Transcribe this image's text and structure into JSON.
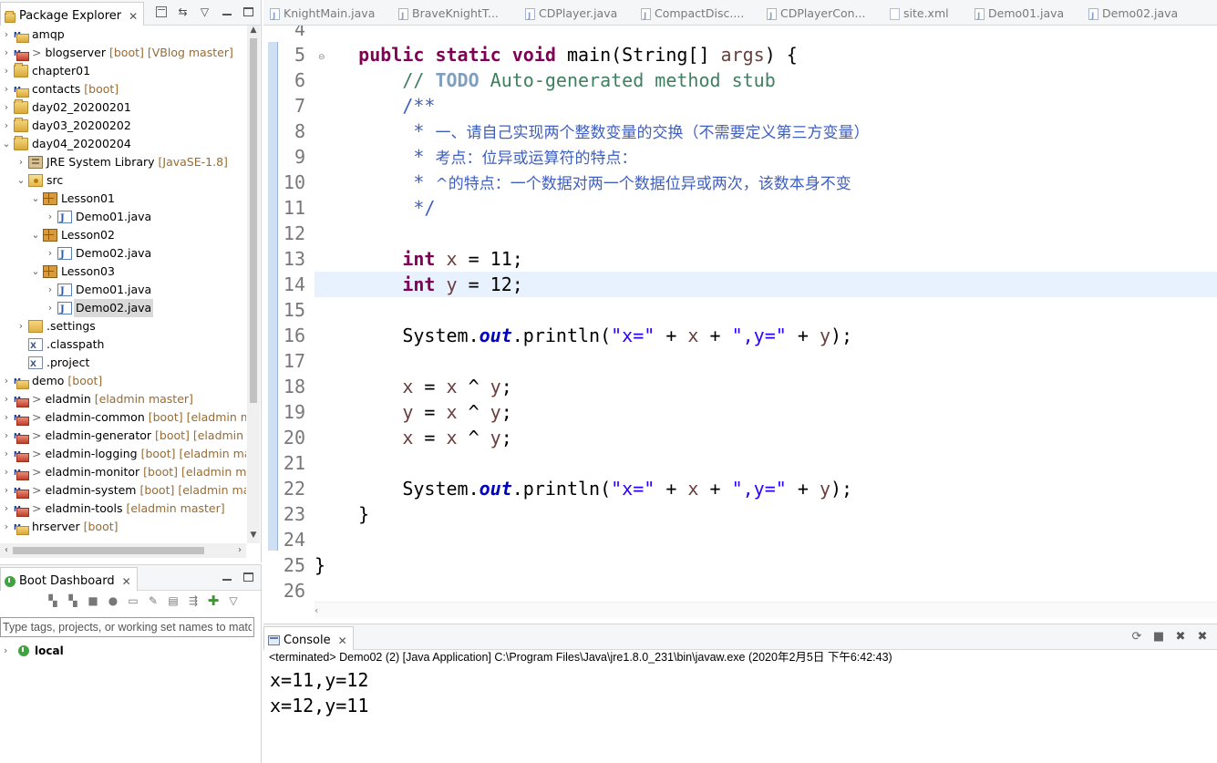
{
  "package_explorer": {
    "title": "Package Explorer",
    "tree": [
      {
        "indent": 0,
        "arrow": "›",
        "icon": "maven-project",
        "label": "amqp",
        "decoration": ""
      },
      {
        "indent": 0,
        "arrow": "›",
        "icon": "maven-project-red",
        "prefix": "> ",
        "label": "blogserver",
        "decoration": " [boot] [VBlog master]"
      },
      {
        "indent": 0,
        "arrow": "›",
        "icon": "project",
        "label": "chapter01",
        "decoration": ""
      },
      {
        "indent": 0,
        "arrow": "›",
        "icon": "maven-project",
        "label": "contacts",
        "decoration": " [boot]"
      },
      {
        "indent": 0,
        "arrow": "›",
        "icon": "project",
        "label": "day02_20200201",
        "decoration": ""
      },
      {
        "indent": 0,
        "arrow": "›",
        "icon": "project",
        "label": "day03_20200202",
        "decoration": ""
      },
      {
        "indent": 0,
        "arrow": "⌄",
        "icon": "project",
        "label": "day04_20200204",
        "decoration": ""
      },
      {
        "indent": 1,
        "arrow": "›",
        "icon": "library",
        "label": "JRE System Library",
        "decoration": " [JavaSE-1.8]"
      },
      {
        "indent": 1,
        "arrow": "⌄",
        "icon": "source-folder",
        "label": "src",
        "decoration": ""
      },
      {
        "indent": 2,
        "arrow": "⌄",
        "icon": "package",
        "label": "Lesson01",
        "decoration": ""
      },
      {
        "indent": 3,
        "arrow": "›",
        "icon": "java-file",
        "label": "Demo01.java",
        "decoration": ""
      },
      {
        "indent": 2,
        "arrow": "⌄",
        "icon": "package",
        "label": "Lesson02",
        "decoration": ""
      },
      {
        "indent": 3,
        "arrow": "›",
        "icon": "java-file",
        "label": "Demo02.java",
        "decoration": ""
      },
      {
        "indent": 2,
        "arrow": "⌄",
        "icon": "package",
        "label": "Lesson03",
        "decoration": ""
      },
      {
        "indent": 3,
        "arrow": "›",
        "icon": "java-file",
        "label": "Demo01.java",
        "decoration": ""
      },
      {
        "indent": 3,
        "arrow": "›",
        "icon": "java-file",
        "label": "Demo02.java",
        "decoration": "",
        "selected": true
      },
      {
        "indent": 1,
        "arrow": "›",
        "icon": "folder",
        "label": ".settings",
        "decoration": ""
      },
      {
        "indent": 1,
        "arrow": "",
        "icon": "xml-file",
        "label": ".classpath",
        "decoration": ""
      },
      {
        "indent": 1,
        "arrow": "",
        "icon": "xml-file",
        "label": ".project",
        "decoration": ""
      },
      {
        "indent": 0,
        "arrow": "›",
        "icon": "maven-project",
        "label": "demo",
        "decoration": " [boot]"
      },
      {
        "indent": 0,
        "arrow": "›",
        "icon": "maven-project-red",
        "prefix": "> ",
        "label": "eladmin",
        "decoration": " [eladmin master]"
      },
      {
        "indent": 0,
        "arrow": "›",
        "icon": "maven-project-red",
        "prefix": "> ",
        "label": "eladmin-common",
        "decoration": " [boot] [eladmin master]"
      },
      {
        "indent": 0,
        "arrow": "›",
        "icon": "maven-project-red",
        "prefix": "> ",
        "label": "eladmin-generator",
        "decoration": " [boot] [eladmin master]"
      },
      {
        "indent": 0,
        "arrow": "›",
        "icon": "maven-project-red",
        "prefix": "> ",
        "label": "eladmin-logging",
        "decoration": " [boot] [eladmin master]"
      },
      {
        "indent": 0,
        "arrow": "›",
        "icon": "maven-project-red",
        "prefix": "> ",
        "label": "eladmin-monitor",
        "decoration": " [boot] [eladmin master]"
      },
      {
        "indent": 0,
        "arrow": "›",
        "icon": "maven-project-red",
        "prefix": "> ",
        "label": "eladmin-system",
        "decoration": " [boot] [eladmin master]"
      },
      {
        "indent": 0,
        "arrow": "›",
        "icon": "maven-project-red",
        "prefix": "> ",
        "label": "eladmin-tools",
        "decoration": " [eladmin master]"
      },
      {
        "indent": 0,
        "arrow": "›",
        "icon": "maven-project",
        "label": "hrserver",
        "decoration": " [boot]"
      }
    ]
  },
  "boot_dashboard": {
    "title": "Boot Dashboard",
    "filter_placeholder": "Type tags, projects, or working set names to match",
    "local_label": "local"
  },
  "editor": {
    "tabs": [
      {
        "label": "KnightMain.java",
        "icon": "java-file"
      },
      {
        "label": "BraveKnightT...",
        "icon": "java-file"
      },
      {
        "label": "CDPlayer.java",
        "icon": "java-file"
      },
      {
        "label": "CompactDisc....",
        "icon": "java-file"
      },
      {
        "label": "CDPlayerCon...",
        "icon": "java-file"
      },
      {
        "label": "site.xml",
        "icon": "xml-file"
      },
      {
        "label": "Demo01.java",
        "icon": "java-file"
      },
      {
        "label": "Demo02.java",
        "icon": "java-file"
      }
    ],
    "current_line": 14,
    "lines": [
      {
        "num": "4",
        "tokens": []
      },
      {
        "num": "5",
        "tokens": [
          [
            "",
            "    "
          ],
          [
            "kw",
            "public static void"
          ],
          [
            "",
            " main(String[] "
          ],
          [
            "var",
            "args"
          ],
          [
            "",
            ") {"
          ]
        ]
      },
      {
        "num": "6",
        "tokens": [
          [
            "",
            "        "
          ],
          [
            "cm",
            "// "
          ],
          [
            "todo",
            "TODO"
          ],
          [
            "cm",
            " Auto-generated method stub"
          ]
        ]
      },
      {
        "num": "7",
        "tokens": [
          [
            "",
            "        "
          ],
          [
            "jd",
            "/**"
          ]
        ]
      },
      {
        "num": "8",
        "tokens": [
          [
            "",
            "         "
          ],
          [
            "jd",
            "* "
          ],
          [
            "jdcn",
            "一、请自己实现两个整数变量的交换（不需要定义第三方变量）"
          ]
        ]
      },
      {
        "num": "9",
        "tokens": [
          [
            "",
            "         "
          ],
          [
            "jd",
            "* "
          ],
          [
            "jdcn",
            "考点：位异或运算符的特点："
          ]
        ]
      },
      {
        "num": "10",
        "tokens": [
          [
            "",
            "         "
          ],
          [
            "jd",
            "* "
          ],
          [
            "jdcn",
            "^的特点：一个数据对两一个数据位异或两次，该数本身不变"
          ]
        ]
      },
      {
        "num": "11",
        "tokens": [
          [
            "",
            "         "
          ],
          [
            "jd",
            "*/"
          ]
        ]
      },
      {
        "num": "12",
        "tokens": []
      },
      {
        "num": "13",
        "tokens": [
          [
            "",
            "        "
          ],
          [
            "kw",
            "int"
          ],
          [
            "",
            " "
          ],
          [
            "var",
            "x"
          ],
          [
            "",
            " = 11;"
          ]
        ]
      },
      {
        "num": "14",
        "tokens": [
          [
            "",
            "        "
          ],
          [
            "kw",
            "int"
          ],
          [
            "",
            " "
          ],
          [
            "var",
            "y"
          ],
          [
            "",
            " = 12;"
          ]
        ]
      },
      {
        "num": "15",
        "tokens": []
      },
      {
        "num": "16",
        "tokens": [
          [
            "",
            "        System."
          ],
          [
            "fld",
            "out"
          ],
          [
            "",
            ".println("
          ],
          [
            "str",
            "\"x=\""
          ],
          [
            "",
            " + "
          ],
          [
            "var",
            "x"
          ],
          [
            "",
            " + "
          ],
          [
            "str",
            "\",y=\""
          ],
          [
            "",
            " + "
          ],
          [
            "var",
            "y"
          ],
          [
            "",
            ");"
          ]
        ]
      },
      {
        "num": "17",
        "tokens": []
      },
      {
        "num": "18",
        "tokens": [
          [
            "",
            "        "
          ],
          [
            "var",
            "x"
          ],
          [
            "",
            " = "
          ],
          [
            "var",
            "x"
          ],
          [
            "",
            " ^ "
          ],
          [
            "var",
            "y"
          ],
          [
            "",
            ";"
          ]
        ]
      },
      {
        "num": "19",
        "tokens": [
          [
            "",
            "        "
          ],
          [
            "var",
            "y"
          ],
          [
            "",
            " = "
          ],
          [
            "var",
            "x"
          ],
          [
            "",
            " ^ "
          ],
          [
            "var",
            "y"
          ],
          [
            "",
            ";"
          ]
        ]
      },
      {
        "num": "20",
        "tokens": [
          [
            "",
            "        "
          ],
          [
            "var",
            "x"
          ],
          [
            "",
            " = "
          ],
          [
            "var",
            "x"
          ],
          [
            "",
            " ^ "
          ],
          [
            "var",
            "y"
          ],
          [
            "",
            ";"
          ]
        ]
      },
      {
        "num": "21",
        "tokens": []
      },
      {
        "num": "22",
        "tokens": [
          [
            "",
            "        System."
          ],
          [
            "fld",
            "out"
          ],
          [
            "",
            ".println("
          ],
          [
            "str",
            "\"x=\""
          ],
          [
            "",
            " + "
          ],
          [
            "var",
            "x"
          ],
          [
            "",
            " + "
          ],
          [
            "str",
            "\",y=\""
          ],
          [
            "",
            " + "
          ],
          [
            "var",
            "y"
          ],
          [
            "",
            ");"
          ]
        ]
      },
      {
        "num": "23",
        "tokens": [
          [
            "",
            "    }"
          ]
        ]
      },
      {
        "num": "24",
        "tokens": []
      },
      {
        "num": "25",
        "tokens": [
          [
            "",
            "}"
          ]
        ]
      },
      {
        "num": "26",
        "tokens": []
      }
    ]
  },
  "console": {
    "title": "Console",
    "status": "<terminated> Demo02 (2) [Java Application] C:\\Program Files\\Java\\jre1.8.0_231\\bin\\javaw.exe (2020年2月5日 下午6:42:43)",
    "output": [
      "x=11,y=12",
      "x=12,y=11"
    ]
  }
}
